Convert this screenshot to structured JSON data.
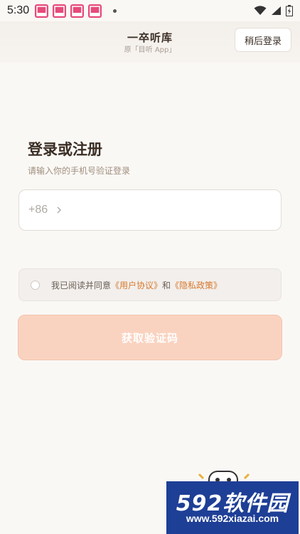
{
  "status_bar": {
    "time": "5:30"
  },
  "header": {
    "title": "一卒听库",
    "subtitle": "原「目听 App」",
    "later_button": "稍后登录"
  },
  "login": {
    "heading": "登录或注册",
    "subheading": "请输入你的手机号验证登录",
    "country_code": "+86",
    "phone_value": "",
    "agreement": {
      "prefix": "我已阅读并同意",
      "user_agreement": "《用户协议》",
      "and": "和",
      "privacy_policy": "《隐私政策》"
    },
    "get_code_button": "获取验证码"
  },
  "watermark": {
    "main": "592软件园",
    "url": "www.592xiazai.com"
  },
  "colors": {
    "background": "#faf8f5",
    "accent": "#d9782e",
    "button_disabled": "#fad3c0",
    "watermark_bg": "#1e3f96"
  },
  "icons": [
    "app-notification-icon",
    "wifi-icon",
    "signal-icon",
    "battery-icon",
    "chevron-right-icon",
    "radio-icon",
    "mascot-icon"
  ]
}
